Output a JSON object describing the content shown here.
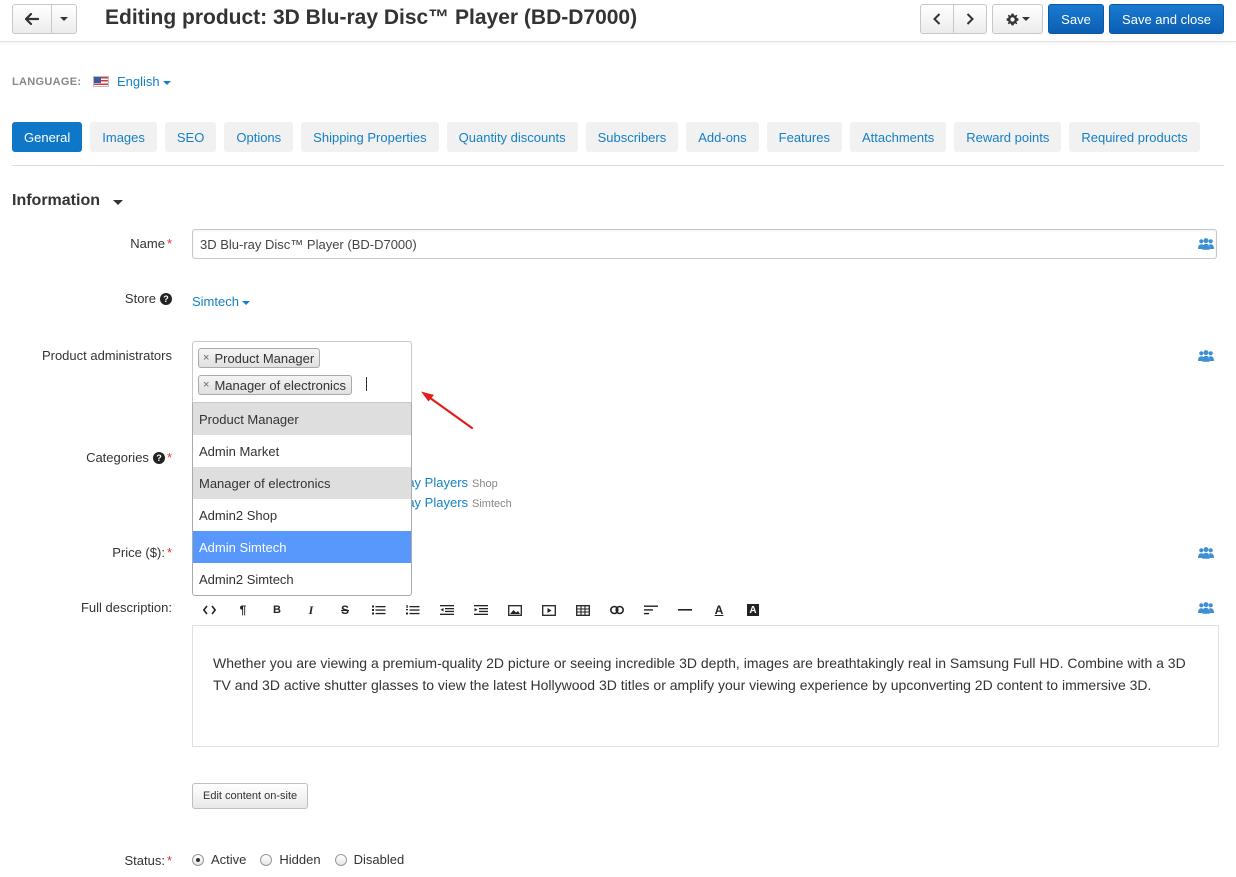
{
  "header": {
    "title": "Editing product: 3D Blu-ray Disc™ Player (BD-D7000)",
    "save_label": "Save",
    "save_close_label": "Save and close"
  },
  "language": {
    "label": "LANGUAGE:",
    "value": "English"
  },
  "tabs": [
    {
      "label": "General",
      "active": true
    },
    {
      "label": "Images"
    },
    {
      "label": "SEO"
    },
    {
      "label": "Options"
    },
    {
      "label": "Shipping Properties"
    },
    {
      "label": "Quantity discounts"
    },
    {
      "label": "Subscribers"
    },
    {
      "label": "Add-ons"
    },
    {
      "label": "Features"
    },
    {
      "label": "Attachments"
    },
    {
      "label": "Reward points"
    },
    {
      "label": "Required products"
    }
  ],
  "section": {
    "title": "Information"
  },
  "fields": {
    "name_label": "Name",
    "name_value": "3D Blu-ray Disc™ Player (BD-D7000)",
    "store_label": "Store",
    "store_value": "Simtech",
    "admins_label": "Product administrators",
    "categories_label": "Categories",
    "price_label": "Price ($):",
    "description_label": "Full description:",
    "status_label": "Status:",
    "required_mark": "*"
  },
  "admins": {
    "selected": [
      "Product Manager",
      "Manager of electronics"
    ],
    "options": [
      {
        "label": "Product Manager",
        "state": "selected"
      },
      {
        "label": "Admin Market",
        "state": ""
      },
      {
        "label": "Manager of electronics",
        "state": "selected"
      },
      {
        "label": "Admin2 Shop",
        "state": ""
      },
      {
        "label": "Admin Simtech",
        "state": "highlighted"
      },
      {
        "label": "Admin2 Simtech",
        "state": ""
      }
    ]
  },
  "categories": [
    {
      "text": "ray Players",
      "store": "Shop"
    },
    {
      "text": "ray Players",
      "store": "Simtech"
    }
  ],
  "editor": {
    "content": "Whether you are viewing a premium-quality 2D picture or seeing incredible 3D depth, images are breathtakingly real in Samsung Full HD. Combine with a 3D TV and 3D active shutter glasses to view the latest Hollywood 3D titles or amplify your viewing experience by upconverting 2D content to immersive 3D.",
    "edit_onsite_label": "Edit content on-site"
  },
  "status": {
    "options": [
      "Active",
      "Hidden",
      "Disabled"
    ],
    "selected": "Active"
  },
  "colors": {
    "accent": "#0e77c8",
    "link": "#1480c8",
    "required": "#d9343a",
    "highlight": "#5897fb"
  }
}
